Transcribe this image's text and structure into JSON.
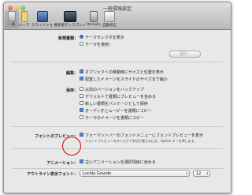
{
  "window": {
    "title": "一般環境設定"
  },
  "toolbar": {
    "items": [
      {
        "label": "一般",
        "icon": "toggle-switches-icon",
        "selected": true
      },
      {
        "label": "ルーラ",
        "icon": "ruler-icon"
      },
      {
        "label": "スライドショー",
        "icon": "slideshow-icon"
      },
      {
        "label": "発表者ディスプレイ",
        "icon": "presenter-display-icon"
      },
      {
        "label": "Remote",
        "icon": "remote-icon"
      },
      {
        "label": "自動修正",
        "icon": "autocorrect-icon"
      }
    ]
  },
  "new_document": {
    "label": "新規書類：",
    "option_theme_chooser": "テーマセレクタを表示",
    "option_use_theme": "テーマを使用：",
    "choose_button": "選択..."
  },
  "editing": {
    "label": "編集：",
    "items": [
      {
        "text": "オブジェクトの移動時にサイズと位置を表示",
        "checked": true
      },
      {
        "text": "配置したイメージをスライドのサイズまで縮小",
        "checked": true
      }
    ]
  },
  "saving": {
    "label": "保存：",
    "items": [
      {
        "text": "以前のバージョンをバックアップ",
        "checked": false
      },
      {
        "text": "デフォルトで書類にプレビューを含める",
        "checked": false
      },
      {
        "text": "新しい書類をパッケージとして保存",
        "checked": false
      },
      {
        "text": "オーディオとムービーを書類にコピー",
        "checked": true
      },
      {
        "text": "テーマのイメージを書類にコピー",
        "checked": false
      }
    ]
  },
  "font_preview": {
    "label": "フォントのプレビュー：",
    "text": "フォーマットバーのフォントメニューにフォントプレビューを表示",
    "checked": true,
    "note": "フォントプレビューのオンとオフを切り替えるには、Option キーを押します。"
  },
  "animation": {
    "label": "アニメーション：",
    "text": "古いアニメーションを選択項目に含める",
    "checked": true
  },
  "outline_font": {
    "label": "アウトライン表示フォント：",
    "font": "Lucida Grande",
    "size": "12"
  },
  "colors": {
    "accent": "#4a7ed8",
    "highlight_circle": "#d90000"
  }
}
